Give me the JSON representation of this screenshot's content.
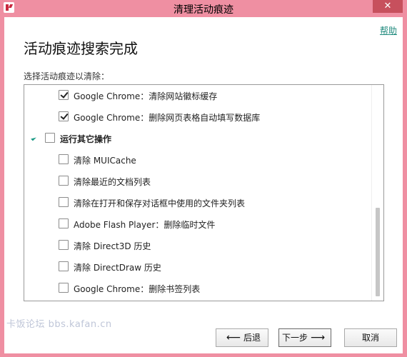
{
  "window": {
    "title": "清理活动痕迹",
    "close_glyph": "✕"
  },
  "help_link": "帮助",
  "heading": "活动痕迹搜索完成",
  "prompt": "选择活动痕迹以清除：",
  "items": [
    {
      "label": "Google Chrome：清除网站徽标缓存",
      "checked": true
    },
    {
      "label": "Google Chrome：删除网页表格自动填写数据库",
      "checked": true
    },
    {
      "label": "运行其它操作",
      "checked": false,
      "group": true,
      "expanded": true
    },
    {
      "label": "清除 MUICache",
      "checked": false
    },
    {
      "label": "清除最近的文档列表",
      "checked": false
    },
    {
      "label": "清除在打开和保存对话框中使用的文件夹列表",
      "checked": false
    },
    {
      "label": "Adobe Flash Player：删除临时文件",
      "checked": false
    },
    {
      "label": "清除 Direct3D 历史",
      "checked": false
    },
    {
      "label": "清除 DirectDraw 历史",
      "checked": false
    },
    {
      "label": "Google Chrome：删除书签列表",
      "checked": false
    }
  ],
  "buttons": {
    "back": "后退",
    "next": "下一步",
    "cancel": "取消"
  },
  "watermark": "卡饭论坛 bbs.kafan.cn",
  "colors": {
    "frame": "#ef8fa2",
    "close": "#c7505d",
    "link": "#1f8a7d",
    "expander": "#1b9a85"
  }
}
